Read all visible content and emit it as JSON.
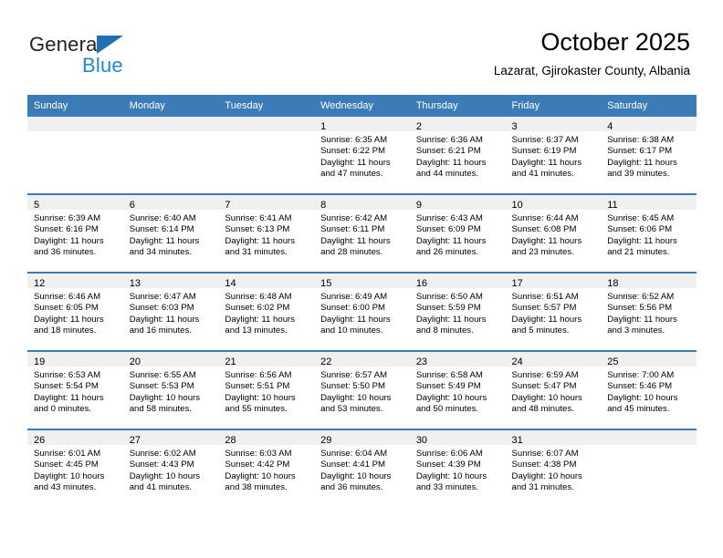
{
  "brand": {
    "name_part1": "General",
    "name_part2": "Blue",
    "triangle_color": "#1f6fb5",
    "blue_text_color": "#2288d6"
  },
  "header": {
    "month_title": "October 2025",
    "location": "Lazarat, Gjirokaster County, Albania"
  },
  "theme": {
    "header_row_bg": "#3b7cb8",
    "header_row_text": "#ffffff",
    "daynum_strip_bg": "#f0f0f0",
    "cell_bg": "#ffffff",
    "row_separator": "#3b7cb8"
  },
  "weekday_headers": [
    "Sunday",
    "Monday",
    "Tuesday",
    "Wednesday",
    "Thursday",
    "Friday",
    "Saturday"
  ],
  "weeks": [
    [
      {
        "day": "",
        "sunrise": "",
        "sunset": "",
        "daylight_line1": "",
        "daylight_line2": "",
        "empty": true
      },
      {
        "day": "",
        "sunrise": "",
        "sunset": "",
        "daylight_line1": "",
        "daylight_line2": "",
        "empty": true
      },
      {
        "day": "",
        "sunrise": "",
        "sunset": "",
        "daylight_line1": "",
        "daylight_line2": "",
        "empty": true
      },
      {
        "day": "1",
        "sunrise": "Sunrise: 6:35 AM",
        "sunset": "Sunset: 6:22 PM",
        "daylight_line1": "Daylight: 11 hours",
        "daylight_line2": "and 47 minutes.",
        "empty": false
      },
      {
        "day": "2",
        "sunrise": "Sunrise: 6:36 AM",
        "sunset": "Sunset: 6:21 PM",
        "daylight_line1": "Daylight: 11 hours",
        "daylight_line2": "and 44 minutes.",
        "empty": false
      },
      {
        "day": "3",
        "sunrise": "Sunrise: 6:37 AM",
        "sunset": "Sunset: 6:19 PM",
        "daylight_line1": "Daylight: 11 hours",
        "daylight_line2": "and 41 minutes.",
        "empty": false
      },
      {
        "day": "4",
        "sunrise": "Sunrise: 6:38 AM",
        "sunset": "Sunset: 6:17 PM",
        "daylight_line1": "Daylight: 11 hours",
        "daylight_line2": "and 39 minutes.",
        "empty": false
      }
    ],
    [
      {
        "day": "5",
        "sunrise": "Sunrise: 6:39 AM",
        "sunset": "Sunset: 6:16 PM",
        "daylight_line1": "Daylight: 11 hours",
        "daylight_line2": "and 36 minutes.",
        "empty": false
      },
      {
        "day": "6",
        "sunrise": "Sunrise: 6:40 AM",
        "sunset": "Sunset: 6:14 PM",
        "daylight_line1": "Daylight: 11 hours",
        "daylight_line2": "and 34 minutes.",
        "empty": false
      },
      {
        "day": "7",
        "sunrise": "Sunrise: 6:41 AM",
        "sunset": "Sunset: 6:13 PM",
        "daylight_line1": "Daylight: 11 hours",
        "daylight_line2": "and 31 minutes.",
        "empty": false
      },
      {
        "day": "8",
        "sunrise": "Sunrise: 6:42 AM",
        "sunset": "Sunset: 6:11 PM",
        "daylight_line1": "Daylight: 11 hours",
        "daylight_line2": "and 28 minutes.",
        "empty": false
      },
      {
        "day": "9",
        "sunrise": "Sunrise: 6:43 AM",
        "sunset": "Sunset: 6:09 PM",
        "daylight_line1": "Daylight: 11 hours",
        "daylight_line2": "and 26 minutes.",
        "empty": false
      },
      {
        "day": "10",
        "sunrise": "Sunrise: 6:44 AM",
        "sunset": "Sunset: 6:08 PM",
        "daylight_line1": "Daylight: 11 hours",
        "daylight_line2": "and 23 minutes.",
        "empty": false
      },
      {
        "day": "11",
        "sunrise": "Sunrise: 6:45 AM",
        "sunset": "Sunset: 6:06 PM",
        "daylight_line1": "Daylight: 11 hours",
        "daylight_line2": "and 21 minutes.",
        "empty": false
      }
    ],
    [
      {
        "day": "12",
        "sunrise": "Sunrise: 6:46 AM",
        "sunset": "Sunset: 6:05 PM",
        "daylight_line1": "Daylight: 11 hours",
        "daylight_line2": "and 18 minutes.",
        "empty": false
      },
      {
        "day": "13",
        "sunrise": "Sunrise: 6:47 AM",
        "sunset": "Sunset: 6:03 PM",
        "daylight_line1": "Daylight: 11 hours",
        "daylight_line2": "and 16 minutes.",
        "empty": false
      },
      {
        "day": "14",
        "sunrise": "Sunrise: 6:48 AM",
        "sunset": "Sunset: 6:02 PM",
        "daylight_line1": "Daylight: 11 hours",
        "daylight_line2": "and 13 minutes.",
        "empty": false
      },
      {
        "day": "15",
        "sunrise": "Sunrise: 6:49 AM",
        "sunset": "Sunset: 6:00 PM",
        "daylight_line1": "Daylight: 11 hours",
        "daylight_line2": "and 10 minutes.",
        "empty": false
      },
      {
        "day": "16",
        "sunrise": "Sunrise: 6:50 AM",
        "sunset": "Sunset: 5:59 PM",
        "daylight_line1": "Daylight: 11 hours",
        "daylight_line2": "and 8 minutes.",
        "empty": false
      },
      {
        "day": "17",
        "sunrise": "Sunrise: 6:51 AM",
        "sunset": "Sunset: 5:57 PM",
        "daylight_line1": "Daylight: 11 hours",
        "daylight_line2": "and 5 minutes.",
        "empty": false
      },
      {
        "day": "18",
        "sunrise": "Sunrise: 6:52 AM",
        "sunset": "Sunset: 5:56 PM",
        "daylight_line1": "Daylight: 11 hours",
        "daylight_line2": "and 3 minutes.",
        "empty": false
      }
    ],
    [
      {
        "day": "19",
        "sunrise": "Sunrise: 6:53 AM",
        "sunset": "Sunset: 5:54 PM",
        "daylight_line1": "Daylight: 11 hours",
        "daylight_line2": "and 0 minutes.",
        "empty": false
      },
      {
        "day": "20",
        "sunrise": "Sunrise: 6:55 AM",
        "sunset": "Sunset: 5:53 PM",
        "daylight_line1": "Daylight: 10 hours",
        "daylight_line2": "and 58 minutes.",
        "empty": false
      },
      {
        "day": "21",
        "sunrise": "Sunrise: 6:56 AM",
        "sunset": "Sunset: 5:51 PM",
        "daylight_line1": "Daylight: 10 hours",
        "daylight_line2": "and 55 minutes.",
        "empty": false
      },
      {
        "day": "22",
        "sunrise": "Sunrise: 6:57 AM",
        "sunset": "Sunset: 5:50 PM",
        "daylight_line1": "Daylight: 10 hours",
        "daylight_line2": "and 53 minutes.",
        "empty": false
      },
      {
        "day": "23",
        "sunrise": "Sunrise: 6:58 AM",
        "sunset": "Sunset: 5:49 PM",
        "daylight_line1": "Daylight: 10 hours",
        "daylight_line2": "and 50 minutes.",
        "empty": false
      },
      {
        "day": "24",
        "sunrise": "Sunrise: 6:59 AM",
        "sunset": "Sunset: 5:47 PM",
        "daylight_line1": "Daylight: 10 hours",
        "daylight_line2": "and 48 minutes.",
        "empty": false
      },
      {
        "day": "25",
        "sunrise": "Sunrise: 7:00 AM",
        "sunset": "Sunset: 5:46 PM",
        "daylight_line1": "Daylight: 10 hours",
        "daylight_line2": "and 45 minutes.",
        "empty": false
      }
    ],
    [
      {
        "day": "26",
        "sunrise": "Sunrise: 6:01 AM",
        "sunset": "Sunset: 4:45 PM",
        "daylight_line1": "Daylight: 10 hours",
        "daylight_line2": "and 43 minutes.",
        "empty": false
      },
      {
        "day": "27",
        "sunrise": "Sunrise: 6:02 AM",
        "sunset": "Sunset: 4:43 PM",
        "daylight_line1": "Daylight: 10 hours",
        "daylight_line2": "and 41 minutes.",
        "empty": false
      },
      {
        "day": "28",
        "sunrise": "Sunrise: 6:03 AM",
        "sunset": "Sunset: 4:42 PM",
        "daylight_line1": "Daylight: 10 hours",
        "daylight_line2": "and 38 minutes.",
        "empty": false
      },
      {
        "day": "29",
        "sunrise": "Sunrise: 6:04 AM",
        "sunset": "Sunset: 4:41 PM",
        "daylight_line1": "Daylight: 10 hours",
        "daylight_line2": "and 36 minutes.",
        "empty": false
      },
      {
        "day": "30",
        "sunrise": "Sunrise: 6:06 AM",
        "sunset": "Sunset: 4:39 PM",
        "daylight_line1": "Daylight: 10 hours",
        "daylight_line2": "and 33 minutes.",
        "empty": false
      },
      {
        "day": "31",
        "sunrise": "Sunrise: 6:07 AM",
        "sunset": "Sunset: 4:38 PM",
        "daylight_line1": "Daylight: 10 hours",
        "daylight_line2": "and 31 minutes.",
        "empty": false
      },
      {
        "day": "",
        "sunrise": "",
        "sunset": "",
        "daylight_line1": "",
        "daylight_line2": "",
        "empty": true
      }
    ]
  ]
}
